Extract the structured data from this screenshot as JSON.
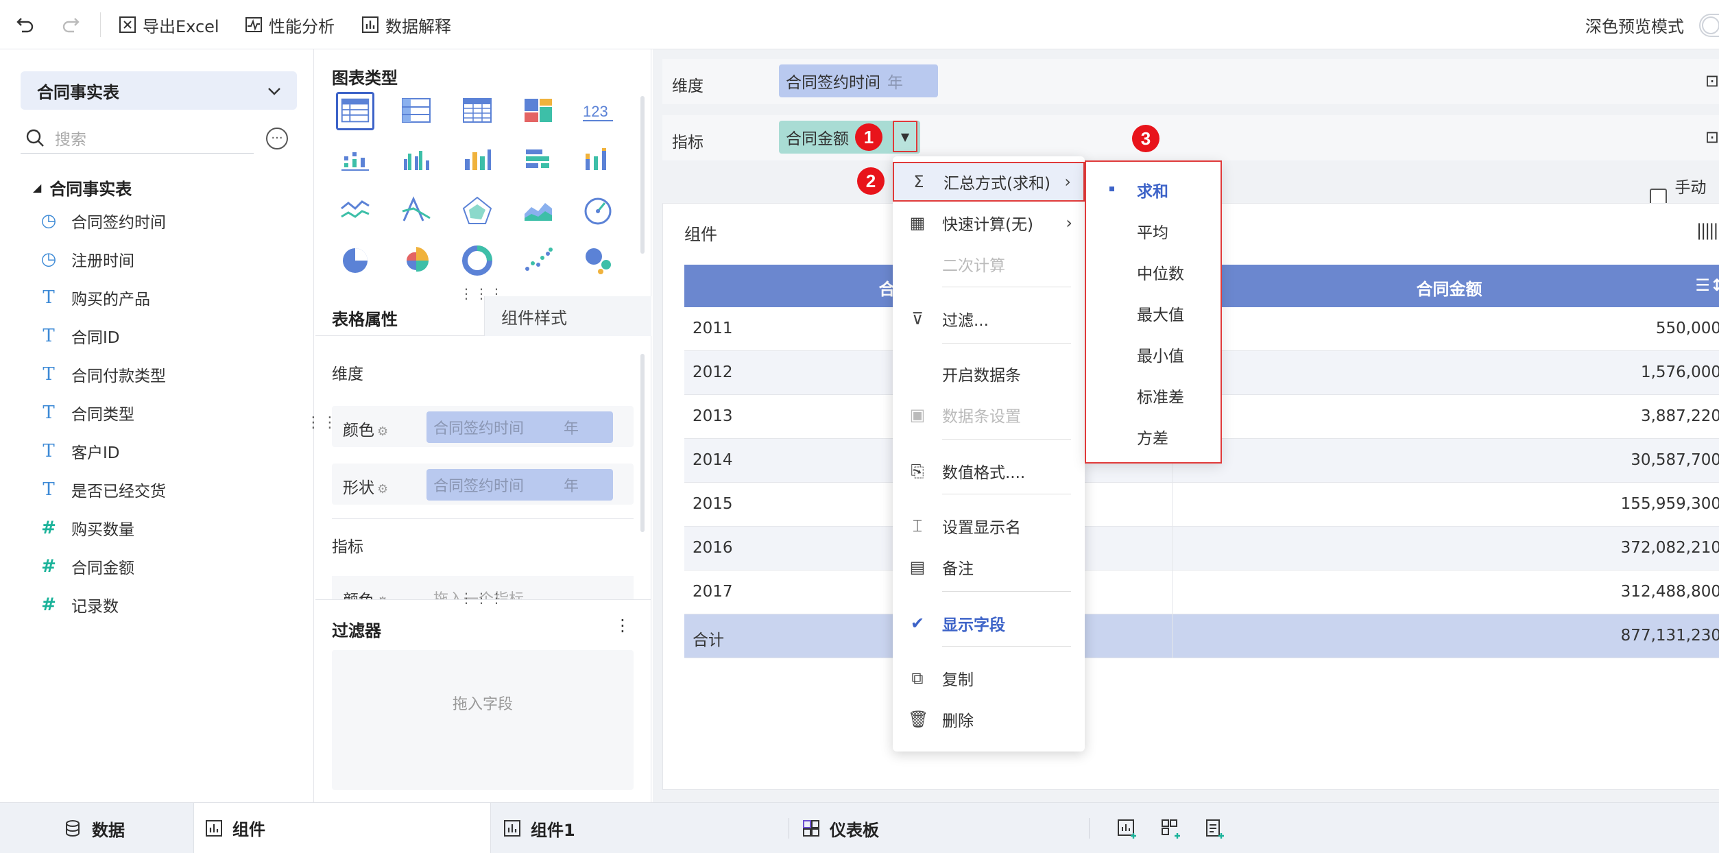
{
  "toolbar": {
    "undo": "undo-icon",
    "redo": "redo-icon",
    "export_excel": "导出Excel",
    "perf_analysis": "性能分析",
    "data_explain": "数据解释",
    "dark_preview": "深色预览模式"
  },
  "data_panel": {
    "table_name": "合同事实表",
    "search_placeholder": "搜索",
    "tree_root": "合同事实表",
    "fields": [
      {
        "type": "time",
        "label": "合同签约时间"
      },
      {
        "type": "time",
        "label": "注册时间"
      },
      {
        "type": "text",
        "label": "购买的产品"
      },
      {
        "type": "text",
        "label": "合同ID"
      },
      {
        "type": "text",
        "label": "合同付款类型"
      },
      {
        "type": "text",
        "label": "合同类型"
      },
      {
        "type": "text",
        "label": "客户ID"
      },
      {
        "type": "text",
        "label": "是否已经交货"
      },
      {
        "type": "number",
        "label": "购买数量"
      },
      {
        "type": "number",
        "label": "合同金额"
      },
      {
        "type": "number",
        "label": "记录数"
      }
    ]
  },
  "chart_panel": {
    "chart_type_title": "图表类型",
    "tab_props": "表格属性",
    "tab_style": "组件样式",
    "dimension_label": "维度",
    "color_label": "颜色",
    "shape_label": "形状",
    "dim_pill": "合同签约时间",
    "dim_unit": "年",
    "metric_label": "指标",
    "metric_color_label": "颜色",
    "metric_placeholder": "拖入一个指标",
    "filter_title": "过滤器",
    "filter_placeholder": "拖入字段"
  },
  "main": {
    "dimension_label": "维度",
    "dimension_pill": "合同签约时间",
    "dimension_unit": "年",
    "metric_label": "指标",
    "metric_pill": "合同金额",
    "manual_label": "手动预",
    "widget_title": "组件",
    "table": {
      "headers": [
        "合同签约时间",
        "合同金额"
      ],
      "rows": [
        [
          "2011",
          "550,000"
        ],
        [
          "2012",
          "1,576,000"
        ],
        [
          "2013",
          "3,887,220"
        ],
        [
          "2014",
          "30,587,700"
        ],
        [
          "2015",
          "155,959,300"
        ],
        [
          "2016",
          "372,082,210"
        ],
        [
          "2017",
          "312,488,800"
        ]
      ],
      "total": [
        "合计",
        "877,131,230"
      ]
    }
  },
  "menu": {
    "items": [
      {
        "label": "汇总方式(求和)",
        "icon": "sigma-icon",
        "submenu": true
      },
      {
        "label": "快速计算(无)",
        "icon": "calculator-icon",
        "submenu": true
      },
      {
        "label": "二次计算",
        "icon": "",
        "disabled": true
      },
      {
        "label": "过滤...",
        "icon": "filter-icon"
      },
      {
        "label": "开启数据条",
        "icon": ""
      },
      {
        "label": "数据条设置",
        "icon": "databar-icon",
        "disabled": true
      },
      {
        "label": "数值格式....",
        "icon": "number-format-icon"
      },
      {
        "label": "设置显示名",
        "icon": "rename-icon"
      },
      {
        "label": "备注",
        "icon": "comment-icon"
      },
      {
        "label": "显示字段",
        "icon": "check-icon",
        "active": true
      },
      {
        "label": "复制",
        "icon": "copy-icon"
      },
      {
        "label": "删除",
        "icon": "trash-icon"
      }
    ],
    "aggregation_options": [
      "求和",
      "平均",
      "中位数",
      "最大值",
      "最小值",
      "标准差",
      "方差"
    ],
    "selected_option": "求和"
  },
  "badges": [
    "1",
    "2",
    "3"
  ],
  "bottom_tabs": {
    "data": "数据",
    "widget": "组件",
    "widget1": "组件1",
    "dashboard": "仪表板"
  },
  "colors": {
    "accent": "#3d63c8",
    "header": "#6b87cf",
    "highlight_border": "#e03a3a",
    "badge": "#e8141b"
  }
}
